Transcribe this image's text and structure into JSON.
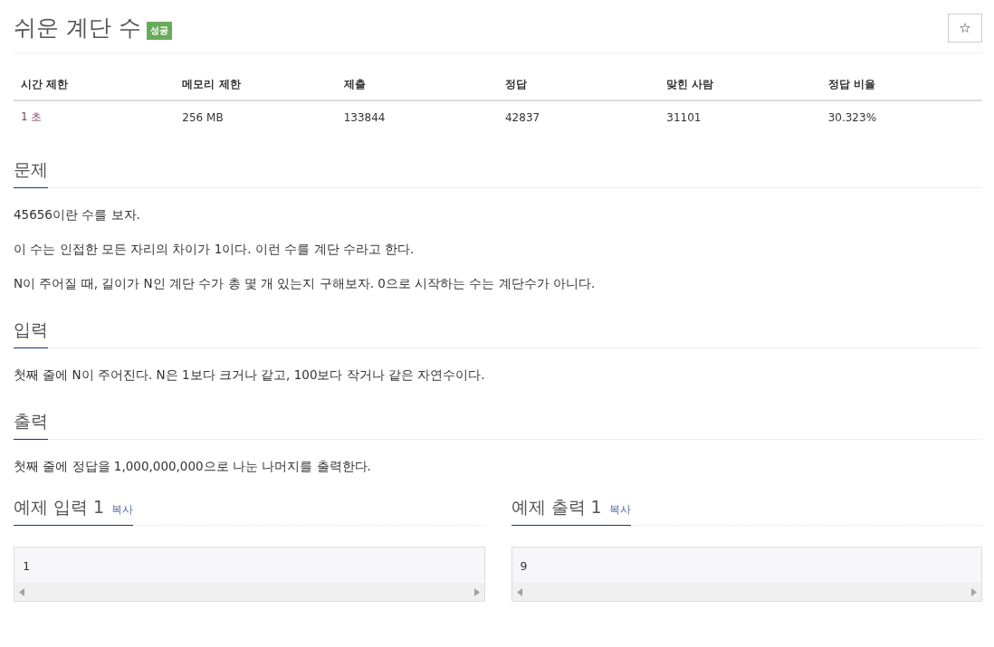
{
  "title": "쉬운 계단 수",
  "status_badge": "성공",
  "star_button": "☆",
  "info_table": {
    "columns": [
      "시간 제한",
      "메모리 제한",
      "제출",
      "정답",
      "맞힌 사람",
      "정답 비율"
    ],
    "rows": [
      [
        "1 초",
        "256 MB",
        "133844",
        "42837",
        "31101",
        "30.323%"
      ]
    ]
  },
  "sections": [
    {
      "heading": "문제",
      "paragraphs": [
        "45656이란 수를 보자.",
        "이 수는 인접한 모든 자리의 차이가 1이다. 이런 수를 계단 수라고 한다.",
        "N이 주어질 때, 길이가 N인 계단 수가 총 몇 개 있는지 구해보자. 0으로 시작하는 수는 계단수가 아니다."
      ]
    },
    {
      "heading": "입력",
      "paragraphs": [
        "첫째 줄에 N이 주어진다. N은 1보다 크거나 같고, 100보다 작거나 같은 자연수이다."
      ]
    },
    {
      "heading": "출력",
      "paragraphs": [
        "첫째 줄에 정답을 1,000,000,000으로 나눈 나머지를 출력한다."
      ]
    }
  ],
  "samples": [
    {
      "heading": "예제 입력 1",
      "copy": "복사",
      "content": "1"
    },
    {
      "heading": "예제 출력 1",
      "copy": "복사",
      "content": "9"
    }
  ]
}
